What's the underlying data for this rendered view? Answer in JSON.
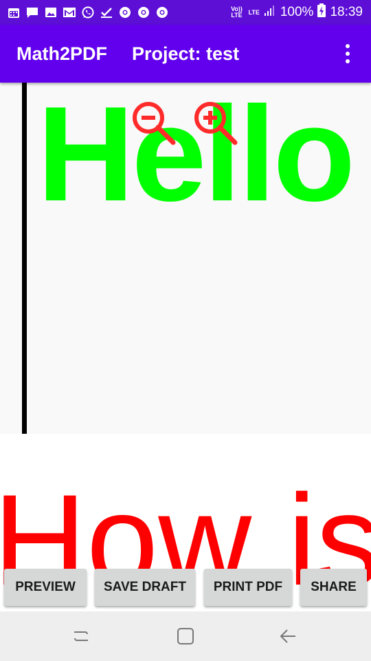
{
  "status_bar": {
    "battery_text": "100%",
    "time": "18:39",
    "volte_label": "Vo)) LTE",
    "lte_label": "LTE",
    "notification_icons": [
      "calendar-icon",
      "message-icon",
      "picture-icon",
      "gmail-icon",
      "whatsapp-icon",
      "checkmark-icon",
      "chrome-icon",
      "chrome-icon",
      "chrome-icon"
    ]
  },
  "app_bar": {
    "app_title": "Math2PDF",
    "project_title": "Project: test",
    "overflow_icon": "more-vert-icon"
  },
  "editor": {
    "text": "Hello",
    "text_color": "#00ff00",
    "zoom_out_icon": "zoom-out-icon",
    "zoom_in_icon": "zoom-in-icon",
    "zoom_icon_color": "#ff2a2a"
  },
  "preview": {
    "text": "How is",
    "text_color": "#ff0000"
  },
  "actions": {
    "preview_label": "PREVIEW",
    "save_draft_label": "SAVE DRAFT",
    "print_pdf_label": "PRINT PDF",
    "share_label": "SHARE"
  },
  "nav_bar": {
    "recents_icon": "recents-icon",
    "home_icon": "home-icon",
    "back_icon": "back-icon"
  },
  "colors": {
    "status_bar": "#5d0fd6",
    "app_bar": "#6200ee",
    "button_bg": "#d6d7d7",
    "nav_bar": "#eeeeee"
  }
}
